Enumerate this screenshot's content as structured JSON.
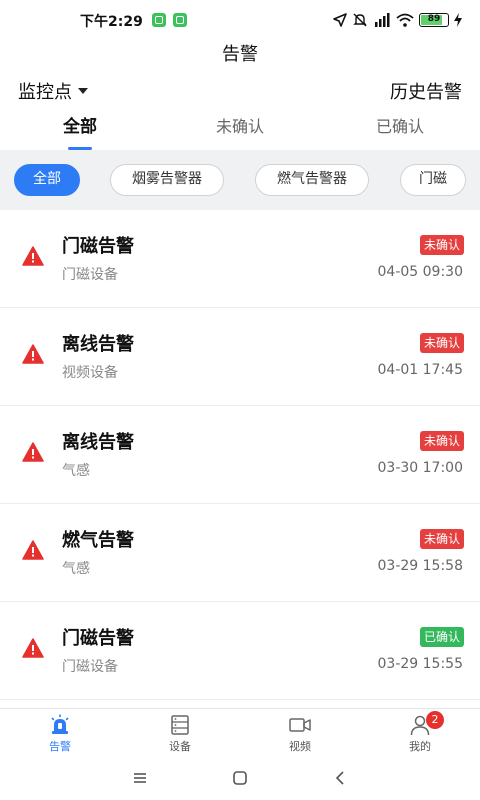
{
  "status_bar": {
    "time": "下午2:29",
    "battery": "89",
    "icons": [
      "location-arrow-icon",
      "mute-icon",
      "signal-icon",
      "wifi-icon",
      "battery-icon",
      "charging-icon"
    ]
  },
  "header": {
    "title": "告警",
    "monitor_point_label": "监控点",
    "history_label": "历史告警"
  },
  "tabs": [
    {
      "label": "全部",
      "active": true
    },
    {
      "label": "未确认",
      "active": false
    },
    {
      "label": "已确认",
      "active": false
    }
  ],
  "filter_chips": [
    {
      "label": "全部",
      "active": true
    },
    {
      "label": "烟雾告警器",
      "active": false
    },
    {
      "label": "燃气告警器",
      "active": false
    },
    {
      "label": "门磁",
      "active": false
    }
  ],
  "alarms": [
    {
      "title": "门磁告警",
      "device": "门磁设备",
      "status": "未确认",
      "time": "04-05 09:30"
    },
    {
      "title": "离线告警",
      "device": "视频设备",
      "status": "未确认",
      "time": "04-01 17:45"
    },
    {
      "title": "离线告警",
      "device": "气感",
      "status": "未确认",
      "time": "03-30 17:00"
    },
    {
      "title": "燃气告警",
      "device": "气感",
      "status": "未确认",
      "time": "03-29 15:58"
    },
    {
      "title": "门磁告警",
      "device": "门磁设备",
      "status": "已确认",
      "time": "03-29 15:55"
    }
  ],
  "bottom_nav": [
    {
      "label": "告警",
      "icon": "alarm-light-icon",
      "active": true
    },
    {
      "label": "设备",
      "icon": "server-icon",
      "active": false
    },
    {
      "label": "视频",
      "icon": "video-camera-icon",
      "active": false
    },
    {
      "label": "我的",
      "icon": "user-icon",
      "active": false,
      "badge": "2"
    }
  ],
  "colors": {
    "accent": "#2d7cf6",
    "unconfirmed": "#e5403f",
    "confirmed": "#33b85c",
    "warning_icon": "#e5302e"
  }
}
